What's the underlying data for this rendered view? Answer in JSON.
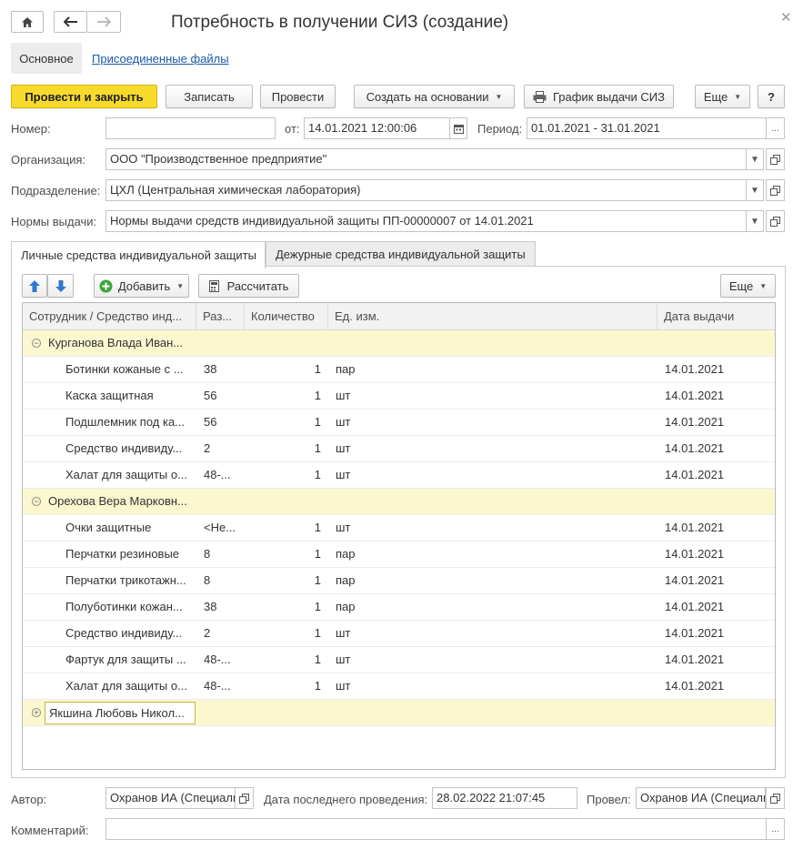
{
  "window": {
    "title": "Потребность в получении СИЗ (создание)"
  },
  "colors": {
    "primary_button": "#f8da2c",
    "link": "#1a5aa7",
    "group_row": "#fbf8d0",
    "icon_green": "#3aa43a",
    "icon_blue": "#2f78d0"
  },
  "nav_tabs": {
    "main": "Основное",
    "files": "Присоединенные файлы"
  },
  "toolbar": {
    "post_close": "Провести и закрыть",
    "save": "Записать",
    "post": "Провести",
    "create_based": "Создать на основании",
    "schedule": "График выдачи СИЗ",
    "more": "Еще",
    "help": "?"
  },
  "form": {
    "number_label": "Номер:",
    "number_value": "",
    "date_label": "от:",
    "date_value": "14.01.2021 12:00:06",
    "period_label": "Период:",
    "period_value": "01.01.2021 - 31.01.2021",
    "org_label": "Организация:",
    "org_value": "ООО \"Производственное предприятие\"",
    "dept_label": "Подразделение:",
    "dept_value": "ЦХЛ (Центральная химическая лаборатория)",
    "norms_label": "Нормы выдачи:",
    "norms_value": "Нормы выдачи средств индивидуальной защиты ПП-00000007 от 14.01.2021"
  },
  "tabs": [
    "Личные средства индивидуальной защиты",
    "Дежурные средства индивидуальной защиты"
  ],
  "table_toolbar": {
    "add": "Добавить",
    "calc": "Рассчитать",
    "more": "Еще"
  },
  "table": {
    "columns": [
      "Сотрудник / Средство инд...",
      "Раз...",
      "Количество",
      "Ед. изм.",
      "Дата выдачи"
    ],
    "groups": [
      {
        "name": "Курганова Влада Иван...",
        "expanded": true,
        "items": [
          {
            "name": "Ботинки кожаные с ...",
            "size": "38",
            "qty": "1",
            "unit": "пар",
            "date": "14.01.2021"
          },
          {
            "name": "Каска защитная",
            "size": "56",
            "qty": "1",
            "unit": "шт",
            "date": "14.01.2021"
          },
          {
            "name": "Подшлемник под ка...",
            "size": "56",
            "qty": "1",
            "unit": "шт",
            "date": "14.01.2021"
          },
          {
            "name": "Средство индивиду...",
            "size": "2",
            "qty": "1",
            "unit": "шт",
            "date": "14.01.2021"
          },
          {
            "name": "Халат для защиты о...",
            "size": "48-...",
            "qty": "1",
            "unit": "шт",
            "date": "14.01.2021"
          }
        ]
      },
      {
        "name": "Орехова Вера Марковн...",
        "expanded": true,
        "items": [
          {
            "name": "Очки защитные",
            "size": "<Не...",
            "qty": "1",
            "unit": "шт",
            "date": "14.01.2021"
          },
          {
            "name": "Перчатки резиновые",
            "size": "8",
            "qty": "1",
            "unit": "пар",
            "date": "14.01.2021"
          },
          {
            "name": "Перчатки трикотажн...",
            "size": "8",
            "qty": "1",
            "unit": "пар",
            "date": "14.01.2021"
          },
          {
            "name": "Полуботинки кожан...",
            "size": "38",
            "qty": "1",
            "unit": "пар",
            "date": "14.01.2021"
          },
          {
            "name": "Средство индивиду...",
            "size": "2",
            "qty": "1",
            "unit": "шт",
            "date": "14.01.2021"
          },
          {
            "name": "Фартук для защиты ...",
            "size": "48-...",
            "qty": "1",
            "unit": "шт",
            "date": "14.01.2021"
          },
          {
            "name": "Халат для защиты о...",
            "size": "48-...",
            "qty": "1",
            "unit": "шт",
            "date": "14.01.2021"
          }
        ]
      },
      {
        "name": "Якшина Любовь Никол...",
        "expanded": false,
        "items": []
      }
    ]
  },
  "footer": {
    "author_label": "Автор:",
    "author_value": "Охранов ИА (Специали",
    "last_post_label": "Дата последнего проведения:",
    "last_post_value": "28.02.2022 21:07:45",
    "poster_label": "Провел:",
    "poster_value": "Охранов ИА (Специали",
    "comment_label": "Комментарий:",
    "comment_value": ""
  }
}
